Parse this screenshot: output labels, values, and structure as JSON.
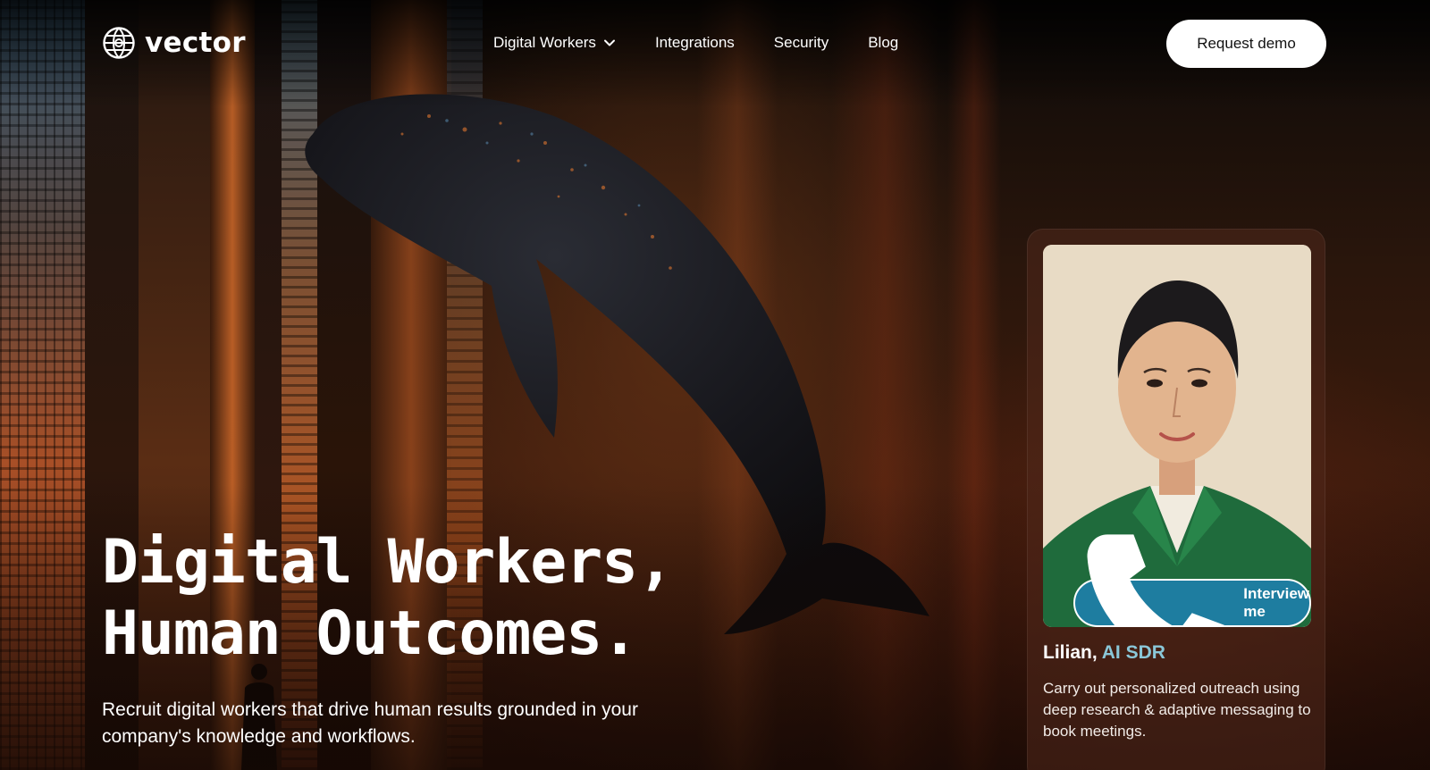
{
  "brand": {
    "name": "vector",
    "logo_icon": "globe-grid-icon"
  },
  "nav": {
    "items": [
      {
        "label": "Digital Workers",
        "has_dropdown": true,
        "icon": "chevron-down-icon"
      },
      {
        "label": "Integrations"
      },
      {
        "label": "Security"
      },
      {
        "label": "Blog"
      }
    ],
    "cta_label": "Request demo"
  },
  "hero": {
    "headline_line1": "Digital Workers,",
    "headline_line2": "Human Outcomes.",
    "subtitle": "Recruit digital workers that drive human results grounded in your company's knowledge and workflows."
  },
  "worker_card": {
    "name": "Lilian,",
    "role": "AI SDR",
    "description": "Carry out personalized outreach using deep research & adaptive messaging to book meetings.",
    "call_label": "Interview me",
    "call_icon": "phone-icon",
    "accent_color": "#1e7da0",
    "role_color": "#8ac7d8"
  }
}
